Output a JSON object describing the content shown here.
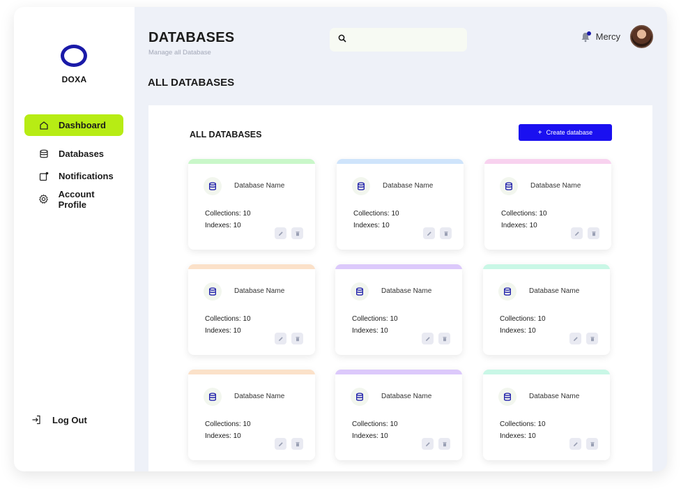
{
  "brand": {
    "name": "DOXA"
  },
  "sidebar": {
    "items": [
      {
        "label": "Dashboard",
        "icon": "home-icon",
        "active": true
      },
      {
        "label": "Databases",
        "icon": "database-icon",
        "active": false
      },
      {
        "label": "Notifications",
        "icon": "notification-icon",
        "active": false
      },
      {
        "label": "Account Profile",
        "icon": "gear-icon",
        "active": false
      }
    ],
    "logout_label": "Log Out"
  },
  "header": {
    "title": "DATABASES",
    "subtitle": "Manage all Database",
    "search_placeholder": "",
    "user_name": "Mercy"
  },
  "section_title": "ALL DATABASES",
  "panel": {
    "title": "ALL DATABASES",
    "create_label": "Create database"
  },
  "cards": [
    {
      "name": "Database Name",
      "collections": "Collections: 10",
      "indexes": "Indexes: 10",
      "accent": "#c9f7c9"
    },
    {
      "name": "Database Name",
      "collections": "Collections: 10",
      "indexes": "Indexes: 10",
      "accent": "#cfe4fb"
    },
    {
      "name": "Database Name",
      "collections": "Collections: 10",
      "indexes": "Indexes: 10",
      "accent": "#f8d2ef"
    },
    {
      "name": "Database Name",
      "collections": "Collections: 10",
      "indexes": "Indexes: 10",
      "accent": "#fbe1c9"
    },
    {
      "name": "Database Name",
      "collections": "Collections: 10",
      "indexes": "Indexes: 10",
      "accent": "#dcc9fb"
    },
    {
      "name": "Database Name",
      "collections": "Collections: 10",
      "indexes": "Indexes: 10",
      "accent": "#c9f7e6"
    },
    {
      "name": "Database Name",
      "collections": "Collections: 10",
      "indexes": "Indexes: 10",
      "accent": "#fbe1c9"
    },
    {
      "name": "Database Name",
      "collections": "Collections: 10",
      "indexes": "Indexes: 10",
      "accent": "#dcc9fb"
    },
    {
      "name": "Database Name",
      "collections": "Collections: 10",
      "indexes": "Indexes: 10",
      "accent": "#c9f7e6"
    }
  ],
  "colors": {
    "accent": "#b7ec14",
    "primary": "#1a10f0",
    "brand": "#1a1aa8"
  }
}
